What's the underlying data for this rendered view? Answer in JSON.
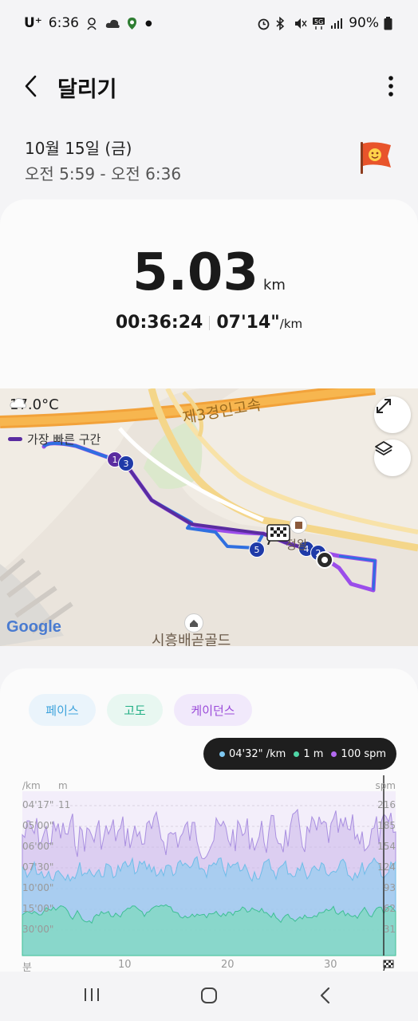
{
  "status": {
    "carrier": "U⁺",
    "time": "6:36",
    "battery": "90%",
    "icons": [
      "dog-icon",
      "cloud-icon",
      "maps-icon",
      "alarm-icon",
      "bluetooth-icon",
      "mute-icon",
      "5g-icon",
      "signal-icon",
      "battery-icon"
    ]
  },
  "header": {
    "title": "달리기"
  },
  "session": {
    "date": "10월 15일 (금)",
    "time_range": "오전 5:59 - 오전 6:36"
  },
  "summary": {
    "distance": "5.03",
    "distance_unit": "km",
    "duration": "00:36:24",
    "pace": "07'14\"",
    "pace_unit": "/km"
  },
  "map": {
    "weather": "17.0°C",
    "legend": "가장 빠른 구간",
    "highway_label": "제3경인고속",
    "poi_label": "시흥배곧골드",
    "place_label": "정왕",
    "attribution": "Google",
    "segment_markers": [
      "1",
      "2",
      "3",
      "4",
      "5"
    ]
  },
  "chips": {
    "pace": "페이스",
    "elevation": "고도",
    "cadence": "케이던스"
  },
  "tooltip": {
    "pace": "04'32\" /km",
    "elevation": "1 m",
    "cadence": "100 spm"
  },
  "chart_data": {
    "type": "area",
    "title": "",
    "left_axis": {
      "units": [
        "/km",
        "m"
      ],
      "pace_ticks": [
        "04'17\"",
        "05'00\"",
        "06'00\"",
        "07'30\"",
        "10'00\"",
        "15'00\"",
        "30'00\""
      ],
      "elevation_ticks": [
        "11"
      ]
    },
    "right_axis": {
      "unit": "spm",
      "ticks": [
        "216",
        "185",
        "154",
        "124",
        "93",
        "62",
        "31"
      ]
    },
    "x_axis": {
      "unit": "분",
      "ticks": [
        "10",
        "20",
        "30"
      ]
    },
    "series": [
      {
        "name": "페이스",
        "color": "#8ecdf0"
      },
      {
        "name": "고도",
        "color": "#7fd9bf"
      },
      {
        "name": "케이던스",
        "color": "#c9b5ea"
      }
    ]
  },
  "colors": {
    "pace": "#3ea3dc",
    "elevation": "#1fae84",
    "cadence": "#9a4ad9",
    "route_fast": "#5a2ca0"
  }
}
